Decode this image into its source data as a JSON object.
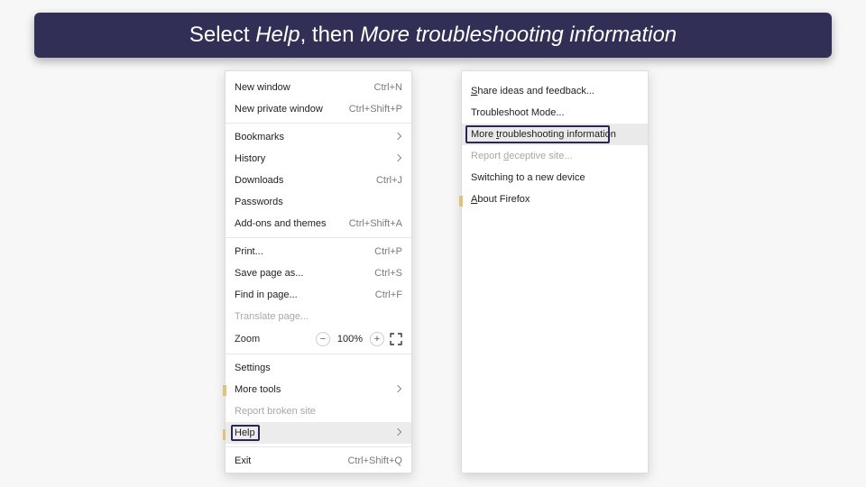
{
  "banner": {
    "prefix": "Select ",
    "em1": "Help",
    "mid": ", then ",
    "em2": "More troubleshooting information"
  },
  "left_menu": {
    "new_window": {
      "label": "New window",
      "shortcut": "Ctrl+N"
    },
    "new_private": {
      "label": "New private window",
      "shortcut": "Ctrl+Shift+P"
    },
    "bookmarks": {
      "label": "Bookmarks"
    },
    "history": {
      "label": "History"
    },
    "downloads": {
      "label": "Downloads",
      "shortcut": "Ctrl+J"
    },
    "passwords": {
      "label": "Passwords"
    },
    "addons": {
      "label": "Add-ons and themes",
      "shortcut": "Ctrl+Shift+A"
    },
    "print": {
      "label": "Print...",
      "shortcut": "Ctrl+P"
    },
    "save_as": {
      "label": "Save page as...",
      "shortcut": "Ctrl+S"
    },
    "find": {
      "label": "Find in page...",
      "shortcut": "Ctrl+F"
    },
    "translate": {
      "label": "Translate page..."
    },
    "zoom": {
      "label": "Zoom",
      "value": "100%"
    },
    "settings": {
      "label": "Settings"
    },
    "more_tools": {
      "label": "More tools"
    },
    "report_broken": {
      "label": "Report broken site"
    },
    "help": {
      "label": "Help"
    },
    "exit": {
      "label": "Exit",
      "shortcut": "Ctrl+Shift+Q"
    }
  },
  "right_menu": {
    "share": {
      "prefix": "S",
      "rest": "hare ideas and feedback..."
    },
    "troubleshoot_mode": {
      "label": "Troubleshoot Mode..."
    },
    "more_info": {
      "prefix": "More ",
      "u": "t",
      "rest": "roubleshooting information"
    },
    "report_deceptive": {
      "prefix": "Report ",
      "u": "d",
      "rest": "eceptive site..."
    },
    "switching": {
      "label": "Switching to a new device"
    },
    "about": {
      "prefix": "A",
      "rest": "bout Firefox"
    }
  }
}
